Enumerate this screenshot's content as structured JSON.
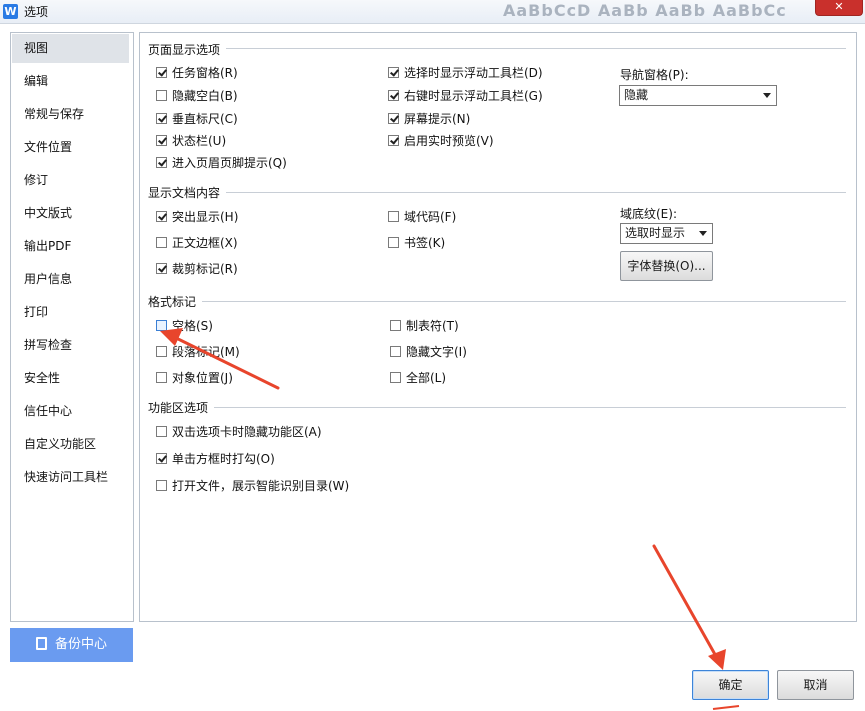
{
  "window": {
    "title": "选项",
    "app_icon": "W",
    "ribbon_preview": "AaBbCcD AaBb AaBb AaBbCc",
    "close_label": "✕"
  },
  "sidebar": {
    "items": [
      {
        "label": "视图",
        "active": true
      },
      {
        "label": "编辑"
      },
      {
        "label": "常规与保存"
      },
      {
        "label": "文件位置"
      },
      {
        "label": "修订"
      },
      {
        "label": "中文版式"
      },
      {
        "label": "输出PDF"
      },
      {
        "label": "用户信息"
      },
      {
        "label": "打印"
      },
      {
        "label": "拼写检查"
      },
      {
        "label": "安全性"
      },
      {
        "label": "信任中心"
      },
      {
        "label": "自定义功能区"
      },
      {
        "label": "快速访问工具栏"
      }
    ],
    "backup_label": "备份中心"
  },
  "sections": {
    "page_display": {
      "title": "页面显示选项",
      "options": [
        {
          "label": "任务窗格(R)",
          "checked": true
        },
        {
          "label": "隐藏空白(B)",
          "checked": false
        },
        {
          "label": "垂直标尺(C)",
          "checked": true
        },
        {
          "label": "状态栏(U)",
          "checked": true
        },
        {
          "label": "进入页眉页脚提示(Q)",
          "checked": true
        },
        {
          "label": "选择时显示浮动工具栏(D)",
          "checked": true
        },
        {
          "label": "右键时显示浮动工具栏(G)",
          "checked": true
        },
        {
          "label": "屏幕提示(N)",
          "checked": true
        },
        {
          "label": "启用实时预览(V)",
          "checked": true
        }
      ],
      "nav_pane_label": "导航窗格(P):",
      "nav_pane_value": "隐藏"
    },
    "doc_content": {
      "title": "显示文档内容",
      "options": [
        {
          "label": "突出显示(H)",
          "checked": true
        },
        {
          "label": "正文边框(X)",
          "checked": false
        },
        {
          "label": "裁剪标记(R)",
          "checked": true
        },
        {
          "label": "域代码(F)",
          "checked": false
        },
        {
          "label": "书签(K)",
          "checked": false
        }
      ],
      "field_shading_label": "域底纹(E):",
      "field_shading_value": "选取时显示",
      "font_sub_button": "字体替换(O)..."
    },
    "format_marks": {
      "title": "格式标记",
      "options": [
        {
          "label": "空格(S)",
          "checked": false
        },
        {
          "label": "段落标记(M)",
          "checked": false
        },
        {
          "label": "对象位置(J)",
          "checked": false
        },
        {
          "label": "制表符(T)",
          "checked": false
        },
        {
          "label": "隐藏文字(I)",
          "checked": false
        },
        {
          "label": "全部(L)",
          "checked": false
        }
      ]
    },
    "ribbon": {
      "title": "功能区选项",
      "options": [
        {
          "label": "双击选项卡时隐藏功能区(A)",
          "checked": false
        },
        {
          "label": "单击方框时打勾(O)",
          "checked": true
        },
        {
          "label": "打开文件，展示智能识别目录(W)",
          "checked": false
        }
      ]
    }
  },
  "footer": {
    "ok_label": "确定",
    "cancel_label": "取消"
  },
  "colors": {
    "accent": "#6a9bf0",
    "close": "#c9302c",
    "arrow": "#e8452c"
  }
}
